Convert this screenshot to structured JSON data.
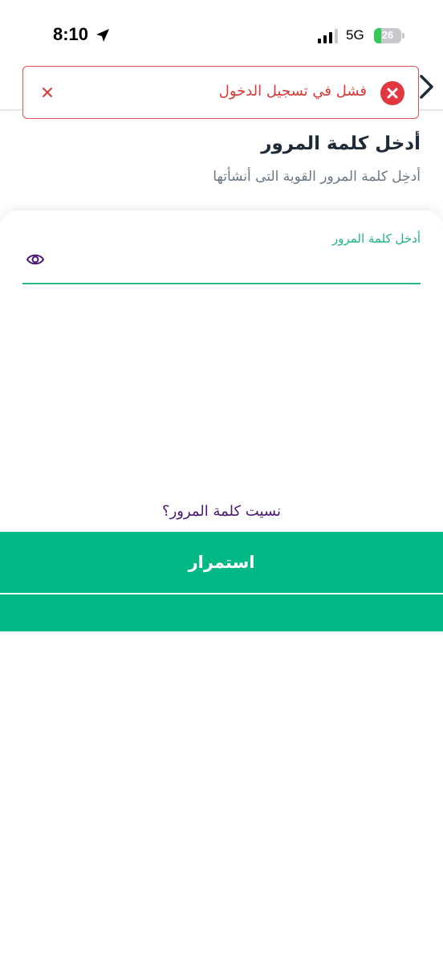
{
  "status_bar": {
    "time": "8:10",
    "network": "5G",
    "battery_level": "26",
    "battery_fraction": 0.26
  },
  "toast": {
    "message": "فشل في تسجيل الدخول",
    "close_symbol": "×",
    "icon": "error-circle-icon",
    "color": "#d73a35"
  },
  "page": {
    "title": "أدخل كلمة المرور",
    "subtitle": "أدخِل كلمة المرور القوية التى أنشأتها"
  },
  "password_field": {
    "label": "أدخل كلمة المرور",
    "value": "",
    "icon": "eye-icon",
    "accent": "#2bb98a"
  },
  "forgot_link": "نسيت كلمة المرور؟",
  "continue_button": {
    "label": "استمرار",
    "color": "#00b986"
  }
}
